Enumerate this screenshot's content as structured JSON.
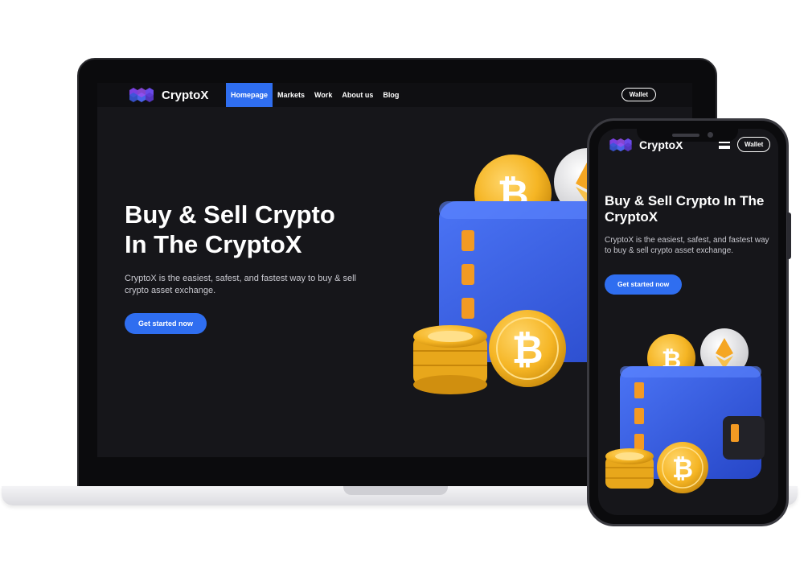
{
  "brand": {
    "name": "CryptoX",
    "accent": "#2f6ef0",
    "bg": "#16161a"
  },
  "nav": {
    "items": [
      {
        "label": "Homepage",
        "active": true
      },
      {
        "label": "Markets",
        "active": false
      },
      {
        "label": "Work",
        "active": false
      },
      {
        "label": "About us",
        "active": false
      },
      {
        "label": "Blog",
        "active": false
      }
    ],
    "wallet_label": "Wallet"
  },
  "hero": {
    "title_line1": "Buy & Sell Crypto",
    "title_line2": "In The CryptoX",
    "description": "CryptoX is the easiest, safest, and fastest way to buy & sell crypto asset exchange.",
    "cta_label": "Get started now"
  },
  "mobile": {
    "brand": "CryptoX",
    "wallet_label": "Wallet",
    "title": "Buy & Sell Crypto In The CryptoX",
    "description": "CryptoX is the easiest, safest, and fastest way to buy & sell crypto asset exchange.",
    "cta_label": "Get started now"
  },
  "icons": {
    "logo": "hexagon-cluster-logo-icon",
    "menu": "hamburger-menu-icon",
    "illustration": "crypto-wallet-with-coins-illustration"
  }
}
